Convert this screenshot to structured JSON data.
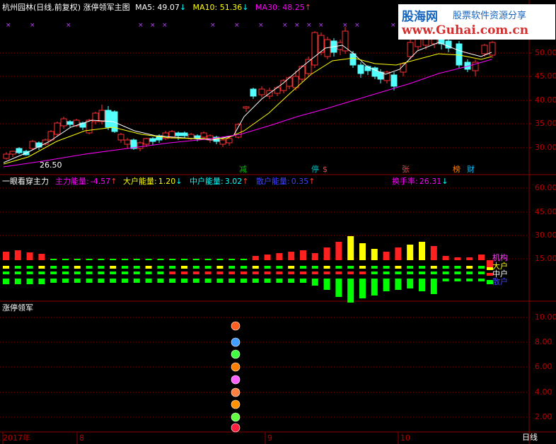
{
  "main_panel": {
    "title": "杭州园林(日线,前复权)",
    "indicator_name": "涨停领军主图",
    "ma5": {
      "label": "MA5:",
      "value": "49.07",
      "arrow": "↓",
      "color": "#ffffff"
    },
    "ma10": {
      "label": "MA10:",
      "value": "51.36",
      "arrow": "↓",
      "color": "#ffff00"
    },
    "ma30": {
      "label": "MA30:",
      "value": "48.25",
      "arrow": "↑",
      "color": "#ff00ff"
    },
    "low_marker": "26.50",
    "y_ticks": [
      "50.00",
      "45.00",
      "40.00",
      "35.00",
      "30.00"
    ],
    "badges": [
      {
        "text": "减",
        "color": "#00c000"
      },
      {
        "text": "停",
        "color": "#00c0c0"
      },
      {
        "text": "$",
        "color": "#ff4040"
      },
      {
        "text": "张",
        "color": "#ff4040"
      },
      {
        "text": "榜",
        "color": "#ff8000"
      },
      {
        "text": "财",
        "color": "#00c0ff"
      }
    ]
  },
  "energy_panel": {
    "title": "一眼看穿主力",
    "items": [
      {
        "label": "主力能量:",
        "value": "-4.57",
        "arrow": "↑",
        "color": "#ff00ff"
      },
      {
        "label": "大户能量:",
        "value": "1.20",
        "arrow": "↓",
        "color": "#ffff00"
      },
      {
        "label": "中户能量:",
        "value": "3.02",
        "arrow": "↑",
        "color": "#00ffff"
      },
      {
        "label": "散户能量:",
        "value": "0.35",
        "arrow": "↑",
        "color": "#4040ff"
      },
      {
        "label": "换手率:",
        "value": "26.31",
        "arrow": "↓",
        "color": "#ff00ff"
      }
    ],
    "y_ticks": [
      "60.00",
      "45.00",
      "30.00",
      "15.00"
    ],
    "legend": [
      {
        "text": "机构",
        "color": "#ff40ff"
      },
      {
        "text": "大户",
        "color": "#ffff00"
      },
      {
        "text": "中户",
        "color": "#ffffff"
      },
      {
        "text": "散户",
        "color": "#4040ff"
      }
    ]
  },
  "signal_panel": {
    "title": "涨停领军",
    "y_ticks": [
      "10.00",
      "8.00",
      "6.00",
      "4.00",
      "2.00"
    ],
    "icons": [
      "butterfly-icon",
      "butterfly-icon",
      "diamond-icon",
      "diamond-icon",
      "diamond-icon",
      "fruit-icon",
      "fruit-icon",
      "apple-icon",
      "pill-icon"
    ]
  },
  "time_axis": {
    "labels": [
      "2017年",
      "8",
      "9",
      "10"
    ],
    "period": "日线"
  },
  "watermark": {
    "brand": "股海网",
    "slogan": "股票软件资源分享",
    "url": "www.Guhai.com.cn"
  },
  "colors": {
    "up": "#ff3030",
    "down": "#54ffff",
    "grid": "#8b0000",
    "background": "#000000"
  }
}
